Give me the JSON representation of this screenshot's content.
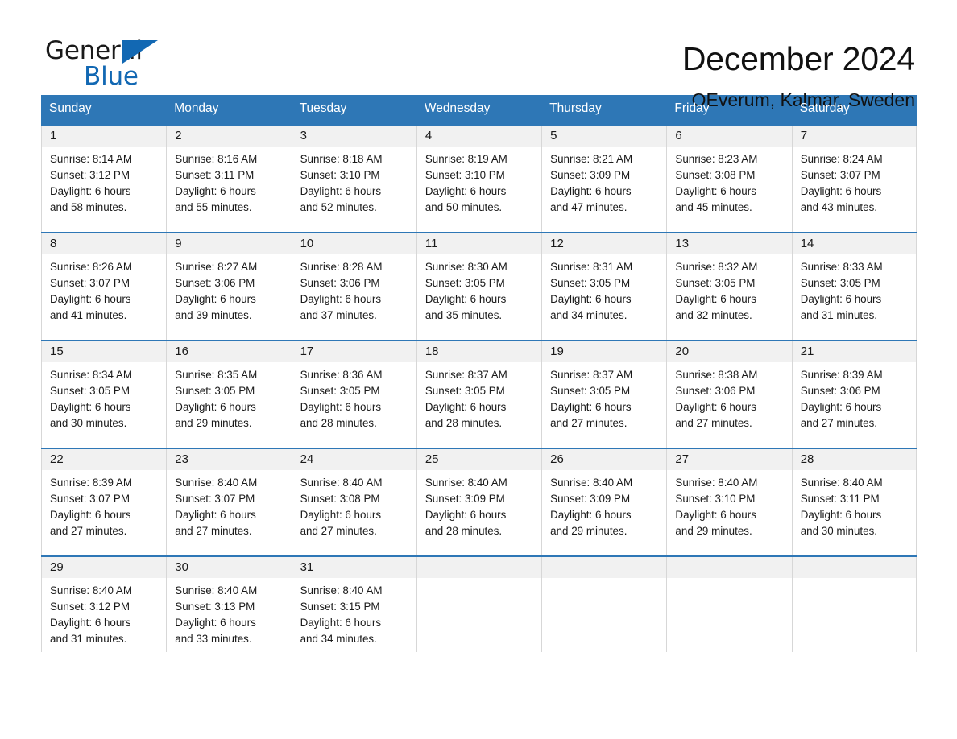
{
  "brand": {
    "name_top": "General",
    "name_bottom": "Blue",
    "triangle_color": "#1268b3",
    "accent_color": "#2e77b6"
  },
  "header": {
    "title": "December 2024",
    "subtitle": "OEverum, Kalmar, Sweden"
  },
  "calendar": {
    "weekdays": [
      "Sunday",
      "Monday",
      "Tuesday",
      "Wednesday",
      "Thursday",
      "Friday",
      "Saturday"
    ],
    "weeks": [
      [
        {
          "day": "1",
          "sunrise": "Sunrise: 8:14 AM",
          "sunset": "Sunset: 3:12 PM",
          "daylight1": "Daylight: 6 hours",
          "daylight2": "and 58 minutes."
        },
        {
          "day": "2",
          "sunrise": "Sunrise: 8:16 AM",
          "sunset": "Sunset: 3:11 PM",
          "daylight1": "Daylight: 6 hours",
          "daylight2": "and 55 minutes."
        },
        {
          "day": "3",
          "sunrise": "Sunrise: 8:18 AM",
          "sunset": "Sunset: 3:10 PM",
          "daylight1": "Daylight: 6 hours",
          "daylight2": "and 52 minutes."
        },
        {
          "day": "4",
          "sunrise": "Sunrise: 8:19 AM",
          "sunset": "Sunset: 3:10 PM",
          "daylight1": "Daylight: 6 hours",
          "daylight2": "and 50 minutes."
        },
        {
          "day": "5",
          "sunrise": "Sunrise: 8:21 AM",
          "sunset": "Sunset: 3:09 PM",
          "daylight1": "Daylight: 6 hours",
          "daylight2": "and 47 minutes."
        },
        {
          "day": "6",
          "sunrise": "Sunrise: 8:23 AM",
          "sunset": "Sunset: 3:08 PM",
          "daylight1": "Daylight: 6 hours",
          "daylight2": "and 45 minutes."
        },
        {
          "day": "7",
          "sunrise": "Sunrise: 8:24 AM",
          "sunset": "Sunset: 3:07 PM",
          "daylight1": "Daylight: 6 hours",
          "daylight2": "and 43 minutes."
        }
      ],
      [
        {
          "day": "8",
          "sunrise": "Sunrise: 8:26 AM",
          "sunset": "Sunset: 3:07 PM",
          "daylight1": "Daylight: 6 hours",
          "daylight2": "and 41 minutes."
        },
        {
          "day": "9",
          "sunrise": "Sunrise: 8:27 AM",
          "sunset": "Sunset: 3:06 PM",
          "daylight1": "Daylight: 6 hours",
          "daylight2": "and 39 minutes."
        },
        {
          "day": "10",
          "sunrise": "Sunrise: 8:28 AM",
          "sunset": "Sunset: 3:06 PM",
          "daylight1": "Daylight: 6 hours",
          "daylight2": "and 37 minutes."
        },
        {
          "day": "11",
          "sunrise": "Sunrise: 8:30 AM",
          "sunset": "Sunset: 3:05 PM",
          "daylight1": "Daylight: 6 hours",
          "daylight2": "and 35 minutes."
        },
        {
          "day": "12",
          "sunrise": "Sunrise: 8:31 AM",
          "sunset": "Sunset: 3:05 PM",
          "daylight1": "Daylight: 6 hours",
          "daylight2": "and 34 minutes."
        },
        {
          "day": "13",
          "sunrise": "Sunrise: 8:32 AM",
          "sunset": "Sunset: 3:05 PM",
          "daylight1": "Daylight: 6 hours",
          "daylight2": "and 32 minutes."
        },
        {
          "day": "14",
          "sunrise": "Sunrise: 8:33 AM",
          "sunset": "Sunset: 3:05 PM",
          "daylight1": "Daylight: 6 hours",
          "daylight2": "and 31 minutes."
        }
      ],
      [
        {
          "day": "15",
          "sunrise": "Sunrise: 8:34 AM",
          "sunset": "Sunset: 3:05 PM",
          "daylight1": "Daylight: 6 hours",
          "daylight2": "and 30 minutes."
        },
        {
          "day": "16",
          "sunrise": "Sunrise: 8:35 AM",
          "sunset": "Sunset: 3:05 PM",
          "daylight1": "Daylight: 6 hours",
          "daylight2": "and 29 minutes."
        },
        {
          "day": "17",
          "sunrise": "Sunrise: 8:36 AM",
          "sunset": "Sunset: 3:05 PM",
          "daylight1": "Daylight: 6 hours",
          "daylight2": "and 28 minutes."
        },
        {
          "day": "18",
          "sunrise": "Sunrise: 8:37 AM",
          "sunset": "Sunset: 3:05 PM",
          "daylight1": "Daylight: 6 hours",
          "daylight2": "and 28 minutes."
        },
        {
          "day": "19",
          "sunrise": "Sunrise: 8:37 AM",
          "sunset": "Sunset: 3:05 PM",
          "daylight1": "Daylight: 6 hours",
          "daylight2": "and 27 minutes."
        },
        {
          "day": "20",
          "sunrise": "Sunrise: 8:38 AM",
          "sunset": "Sunset: 3:06 PM",
          "daylight1": "Daylight: 6 hours",
          "daylight2": "and 27 minutes."
        },
        {
          "day": "21",
          "sunrise": "Sunrise: 8:39 AM",
          "sunset": "Sunset: 3:06 PM",
          "daylight1": "Daylight: 6 hours",
          "daylight2": "and 27 minutes."
        }
      ],
      [
        {
          "day": "22",
          "sunrise": "Sunrise: 8:39 AM",
          "sunset": "Sunset: 3:07 PM",
          "daylight1": "Daylight: 6 hours",
          "daylight2": "and 27 minutes."
        },
        {
          "day": "23",
          "sunrise": "Sunrise: 8:40 AM",
          "sunset": "Sunset: 3:07 PM",
          "daylight1": "Daylight: 6 hours",
          "daylight2": "and 27 minutes."
        },
        {
          "day": "24",
          "sunrise": "Sunrise: 8:40 AM",
          "sunset": "Sunset: 3:08 PM",
          "daylight1": "Daylight: 6 hours",
          "daylight2": "and 27 minutes."
        },
        {
          "day": "25",
          "sunrise": "Sunrise: 8:40 AM",
          "sunset": "Sunset: 3:09 PM",
          "daylight1": "Daylight: 6 hours",
          "daylight2": "and 28 minutes."
        },
        {
          "day": "26",
          "sunrise": "Sunrise: 8:40 AM",
          "sunset": "Sunset: 3:09 PM",
          "daylight1": "Daylight: 6 hours",
          "daylight2": "and 29 minutes."
        },
        {
          "day": "27",
          "sunrise": "Sunrise: 8:40 AM",
          "sunset": "Sunset: 3:10 PM",
          "daylight1": "Daylight: 6 hours",
          "daylight2": "and 29 minutes."
        },
        {
          "day": "28",
          "sunrise": "Sunrise: 8:40 AM",
          "sunset": "Sunset: 3:11 PM",
          "daylight1": "Daylight: 6 hours",
          "daylight2": "and 30 minutes."
        }
      ],
      [
        {
          "day": "29",
          "sunrise": "Sunrise: 8:40 AM",
          "sunset": "Sunset: 3:12 PM",
          "daylight1": "Daylight: 6 hours",
          "daylight2": "and 31 minutes."
        },
        {
          "day": "30",
          "sunrise": "Sunrise: 8:40 AM",
          "sunset": "Sunset: 3:13 PM",
          "daylight1": "Daylight: 6 hours",
          "daylight2": "and 33 minutes."
        },
        {
          "day": "31",
          "sunrise": "Sunrise: 8:40 AM",
          "sunset": "Sunset: 3:15 PM",
          "daylight1": "Daylight: 6 hours",
          "daylight2": "and 34 minutes."
        },
        {
          "day": "",
          "sunrise": "",
          "sunset": "",
          "daylight1": "",
          "daylight2": ""
        },
        {
          "day": "",
          "sunrise": "",
          "sunset": "",
          "daylight1": "",
          "daylight2": ""
        },
        {
          "day": "",
          "sunrise": "",
          "sunset": "",
          "daylight1": "",
          "daylight2": ""
        },
        {
          "day": "",
          "sunrise": "",
          "sunset": "",
          "daylight1": "",
          "daylight2": ""
        }
      ]
    ]
  }
}
